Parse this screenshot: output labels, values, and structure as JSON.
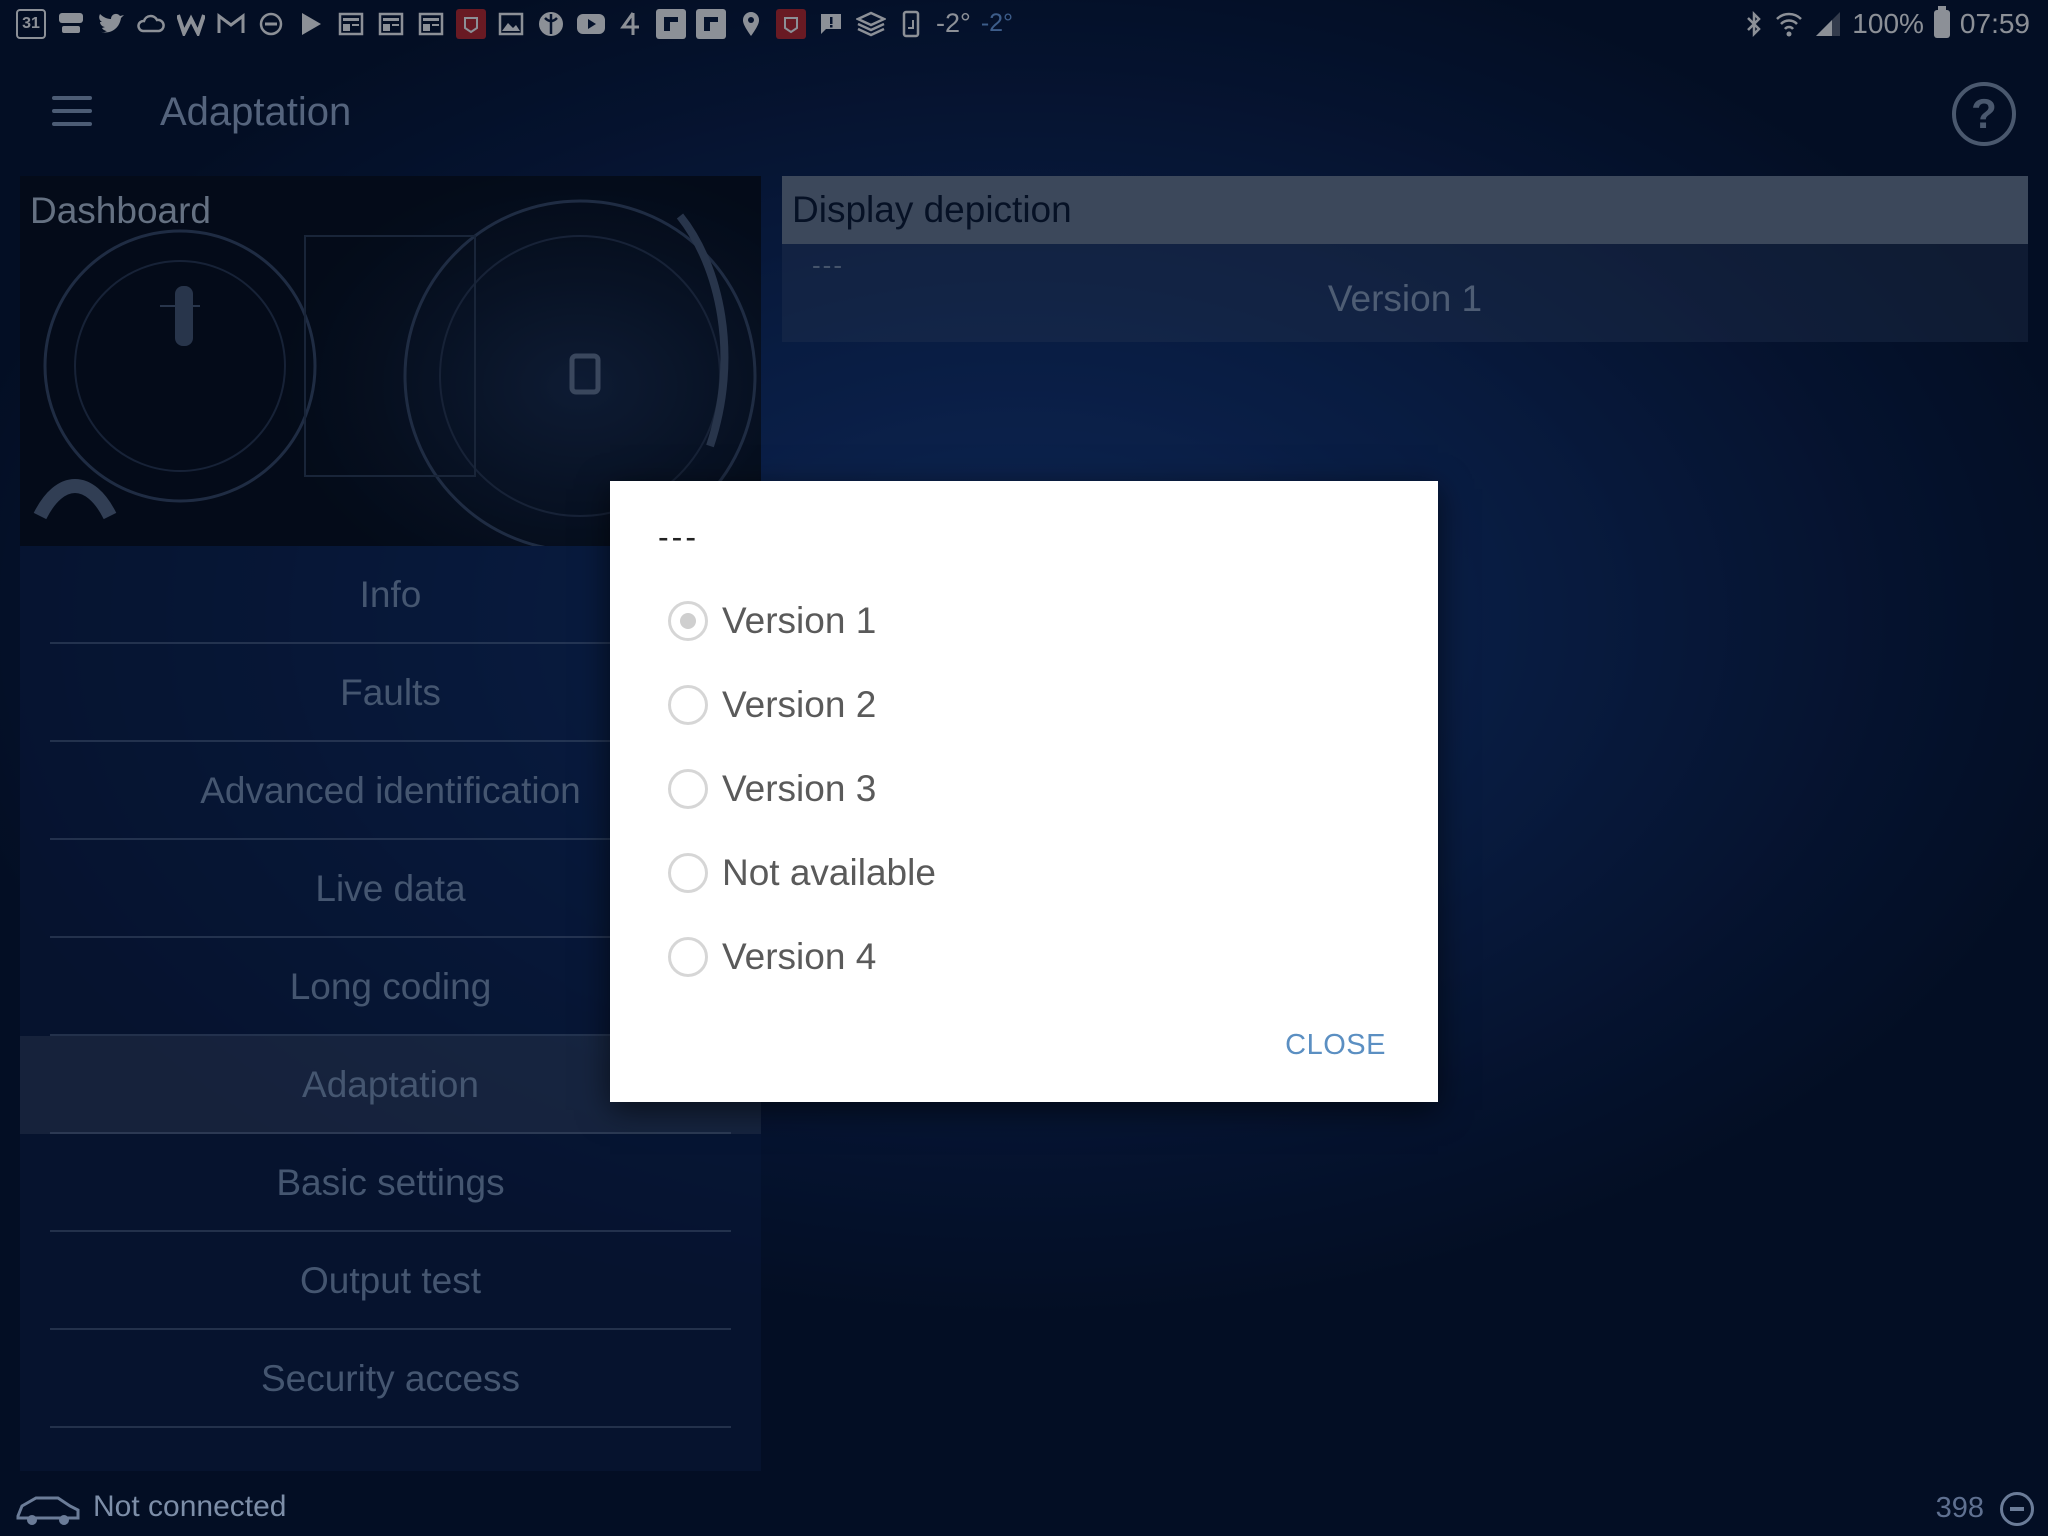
{
  "status_bar": {
    "left_icons": [
      "calendar-icon",
      "sky-news-icon",
      "twitter-icon",
      "cloud-icon",
      "w-icon",
      "gmail-icon",
      "dnd-icon",
      "play-icon",
      "news-icon",
      "news-icon",
      "news-icon",
      "red-app-icon",
      "gallery-icon",
      "browser-icon",
      "youtube-icon",
      "channel4-icon",
      "flipboard-icon",
      "flipboard-icon",
      "location-icon",
      "red-app-icon",
      "message-icon",
      "layers-icon",
      "phone-icon"
    ],
    "calendar_day": "31",
    "temp_white": "-2°",
    "temp_blue": "-2°",
    "battery": "100%",
    "time": "07:59"
  },
  "app_bar": {
    "title": "Adaptation"
  },
  "dashboard": {
    "label": "Dashboard"
  },
  "nav": {
    "items": [
      {
        "label": "Info"
      },
      {
        "label": "Faults"
      },
      {
        "label": "Advanced identification"
      },
      {
        "label": "Live data"
      },
      {
        "label": "Long coding"
      },
      {
        "label": "Adaptation"
      },
      {
        "label": "Basic settings"
      },
      {
        "label": "Output test"
      },
      {
        "label": "Security access"
      }
    ],
    "active": "Adaptation"
  },
  "right_panel": {
    "header": "Display depiction",
    "sub": "---",
    "value": "Version 1"
  },
  "dialog": {
    "title": "---",
    "options": [
      {
        "label": "Version 1",
        "checked": true
      },
      {
        "label": "Version 2",
        "checked": false
      },
      {
        "label": "Version 3",
        "checked": false
      },
      {
        "label": "Not available",
        "checked": false
      },
      {
        "label": "Version 4",
        "checked": false
      }
    ],
    "close_label": "CLOSE"
  },
  "bottom_bar": {
    "connection": "Not connected",
    "counter": "398"
  },
  "colors": {
    "accent": "#5b8fc2",
    "background": "#102c63",
    "dialog": "#ffffff"
  }
}
